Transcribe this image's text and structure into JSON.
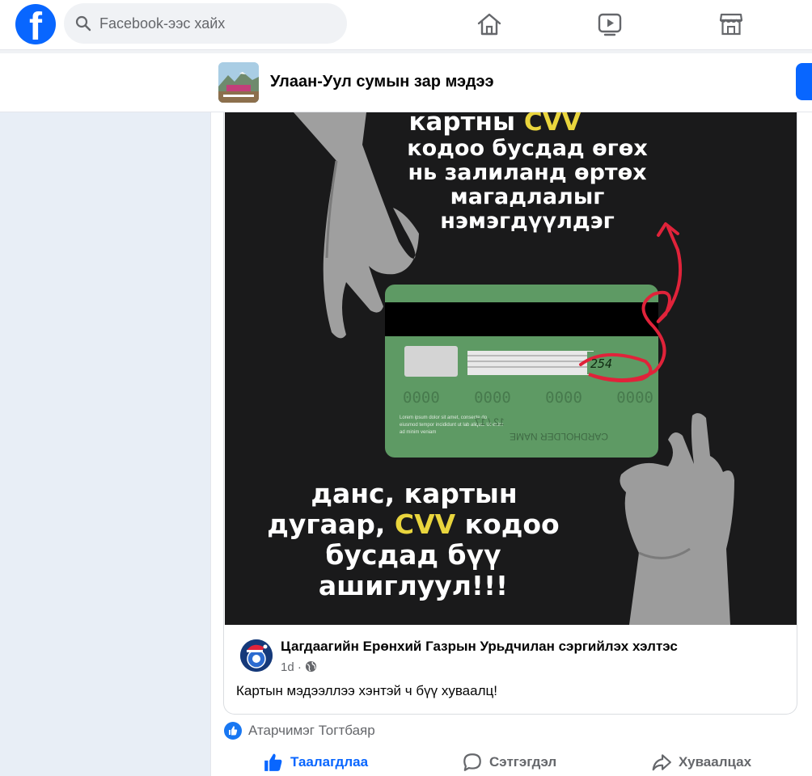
{
  "header": {
    "logo_letter": "f",
    "search_placeholder": "Facebook-ээс хайх",
    "nav": [
      "home-icon",
      "video-icon",
      "marketplace-icon"
    ]
  },
  "page": {
    "name": "Улаан-Уул сумын зар мэдээ"
  },
  "poster": {
    "top_line1_a": "картны ",
    "top_line1_b": "CVV",
    "top_line2": "кодоо бусдад өгөх",
    "top_line3": "нь залиланд өртөх",
    "top_line4": "магадлалыг",
    "top_line5": "нэмэгдүүлдэг",
    "card_cvv": "254",
    "card_number_groups": [
      "0000",
      "0000",
      "0000",
      "0000"
    ],
    "card_small_text": "Lorem ipsum dolor sit amet, consecte do eiusmod tempor incididunt ut lab aliqua. Ut enim ad minim veniam",
    "card_expiry": "12 / 17",
    "card_holder": "CARDHOLDER NAME",
    "bottom_line1": "данс, картын",
    "bottom_line2_a": "дугаар, ",
    "bottom_line2_b": "CVV",
    "bottom_line2_c": " кодоо",
    "bottom_line3": "бусдад бүү",
    "bottom_line4": "ашиглуул!!!"
  },
  "source": {
    "name": "Цагдаагийн Ерөнхий Газрын Урьдчилан сэргийлэх хэлтэс",
    "time": "1d ·",
    "text": "Картын мэдээллээ хэнтэй ч бүү хуваалц!"
  },
  "reactions": {
    "name": "Атарчимэг Тогтбаяр"
  },
  "actions": {
    "like": "Таалагдлаа",
    "comment": "Сэтгэгдэл",
    "share": "Хуваалцах"
  },
  "colors": {
    "brand": "#0866ff",
    "poster_bg": "#1a1a1b",
    "card_green": "#5e9a64",
    "accent_yellow": "#e9d53d",
    "accent_red": "#e0233a"
  }
}
